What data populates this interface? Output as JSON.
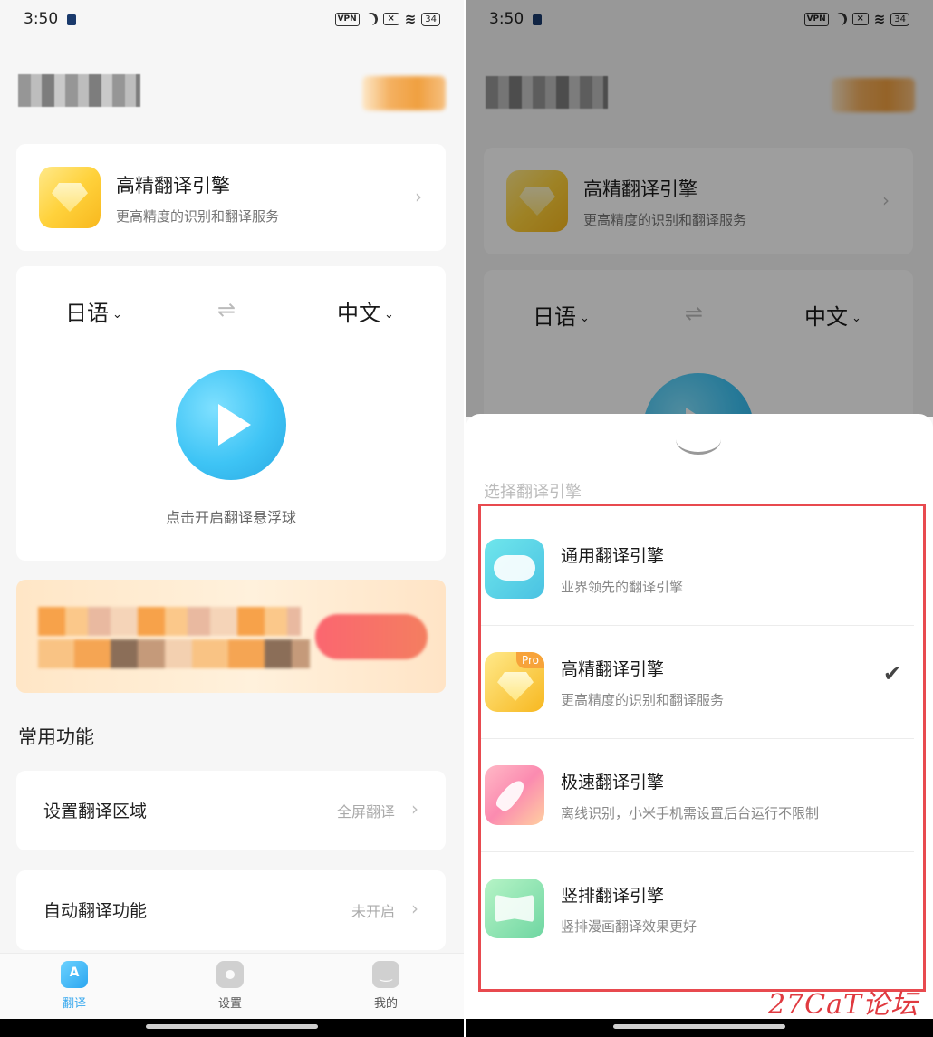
{
  "left": {
    "status": {
      "time": "3:50",
      "vpn": "VPN",
      "battery": "34"
    },
    "engine_card": {
      "title": "高精翻译引擎",
      "desc": "更高精度的识别和翻译服务",
      "chevron": "›"
    },
    "lang": {
      "source": "日语",
      "target": "中文",
      "dropdown": "⌄",
      "swap": "⇌",
      "hint": "点击开启翻译悬浮球"
    },
    "section_title": "常用功能",
    "functions": [
      {
        "label": "设置翻译区域",
        "value": "全屏翻译"
      },
      {
        "label": "自动翻译功能",
        "value": "未开启"
      }
    ],
    "tabs": [
      {
        "label": "翻译",
        "icon": "translate-icon",
        "active": true
      },
      {
        "label": "设置",
        "icon": "gear-icon",
        "active": false
      },
      {
        "label": "我的",
        "icon": "face-icon",
        "active": false
      }
    ]
  },
  "right": {
    "status": {
      "time": "3:50",
      "vpn": "VPN",
      "battery": "34"
    },
    "engine_card": {
      "title": "高精翻译引擎",
      "desc": "更高精度的识别和翻译服务",
      "chevron": "›"
    },
    "lang": {
      "source": "日语",
      "target": "中文",
      "dropdown": "⌄",
      "swap": "⇌"
    },
    "sheet": {
      "title": "选择翻译引擎",
      "options": [
        {
          "title": "通用翻译引擎",
          "desc": "业界领先的翻译引擎",
          "icon": "gamepad-icon",
          "selected": false
        },
        {
          "title": "高精翻译引擎",
          "desc": "更高精度的识别和翻译服务",
          "icon": "diamond-icon",
          "badge": "Pro",
          "selected": true
        },
        {
          "title": "极速翻译引擎",
          "desc": "离线识别，小米手机需设置后台运行不限制",
          "icon": "rocket-icon",
          "selected": false
        },
        {
          "title": "竖排翻译引擎",
          "desc": "竖排漫画翻译效果更好",
          "icon": "book-icon",
          "selected": false
        }
      ],
      "check": "✔"
    },
    "watermark": "27CaT论坛"
  },
  "colors": {
    "accent": "#3ec4f5",
    "highlight_border": "#e84a4f",
    "watermark": "#e03a40"
  }
}
